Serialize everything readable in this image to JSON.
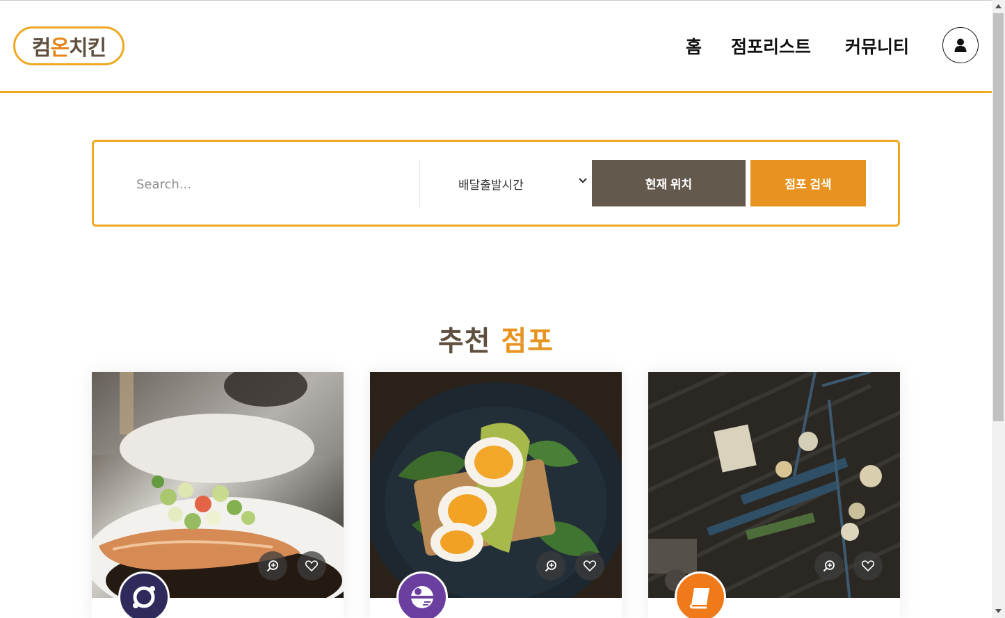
{
  "logo": {
    "text_main": "컴",
    "text_accent": "온",
    "text_rest": "치킨"
  },
  "nav": {
    "items": [
      {
        "label": "홈"
      },
      {
        "label": "점포리스트"
      },
      {
        "label": "커뮤니티"
      }
    ],
    "user_icon": "user-icon"
  },
  "search": {
    "placeholder": "Search...",
    "select_value": "배달출발시간",
    "location_button": "현재 위치",
    "search_button": "점포 검색"
  },
  "section": {
    "title_main": "추천",
    "title_accent": "점포"
  },
  "cards": [
    {
      "image": "salmon-dish-photo",
      "avatar_icon": "ring-logo-icon",
      "avatar_color": "#2e2a5c"
    },
    {
      "image": "egg-toast-photo",
      "avatar_icon": "death-star-icon",
      "avatar_color": "#6a3fa0"
    },
    {
      "image": "restaurant-overhead-photo",
      "avatar_icon": "book-icon",
      "avatar_color": "#f07a1a"
    }
  ],
  "colors": {
    "accent": "#f0a820",
    "brown": "#64594d",
    "orange": "#e8931f"
  }
}
